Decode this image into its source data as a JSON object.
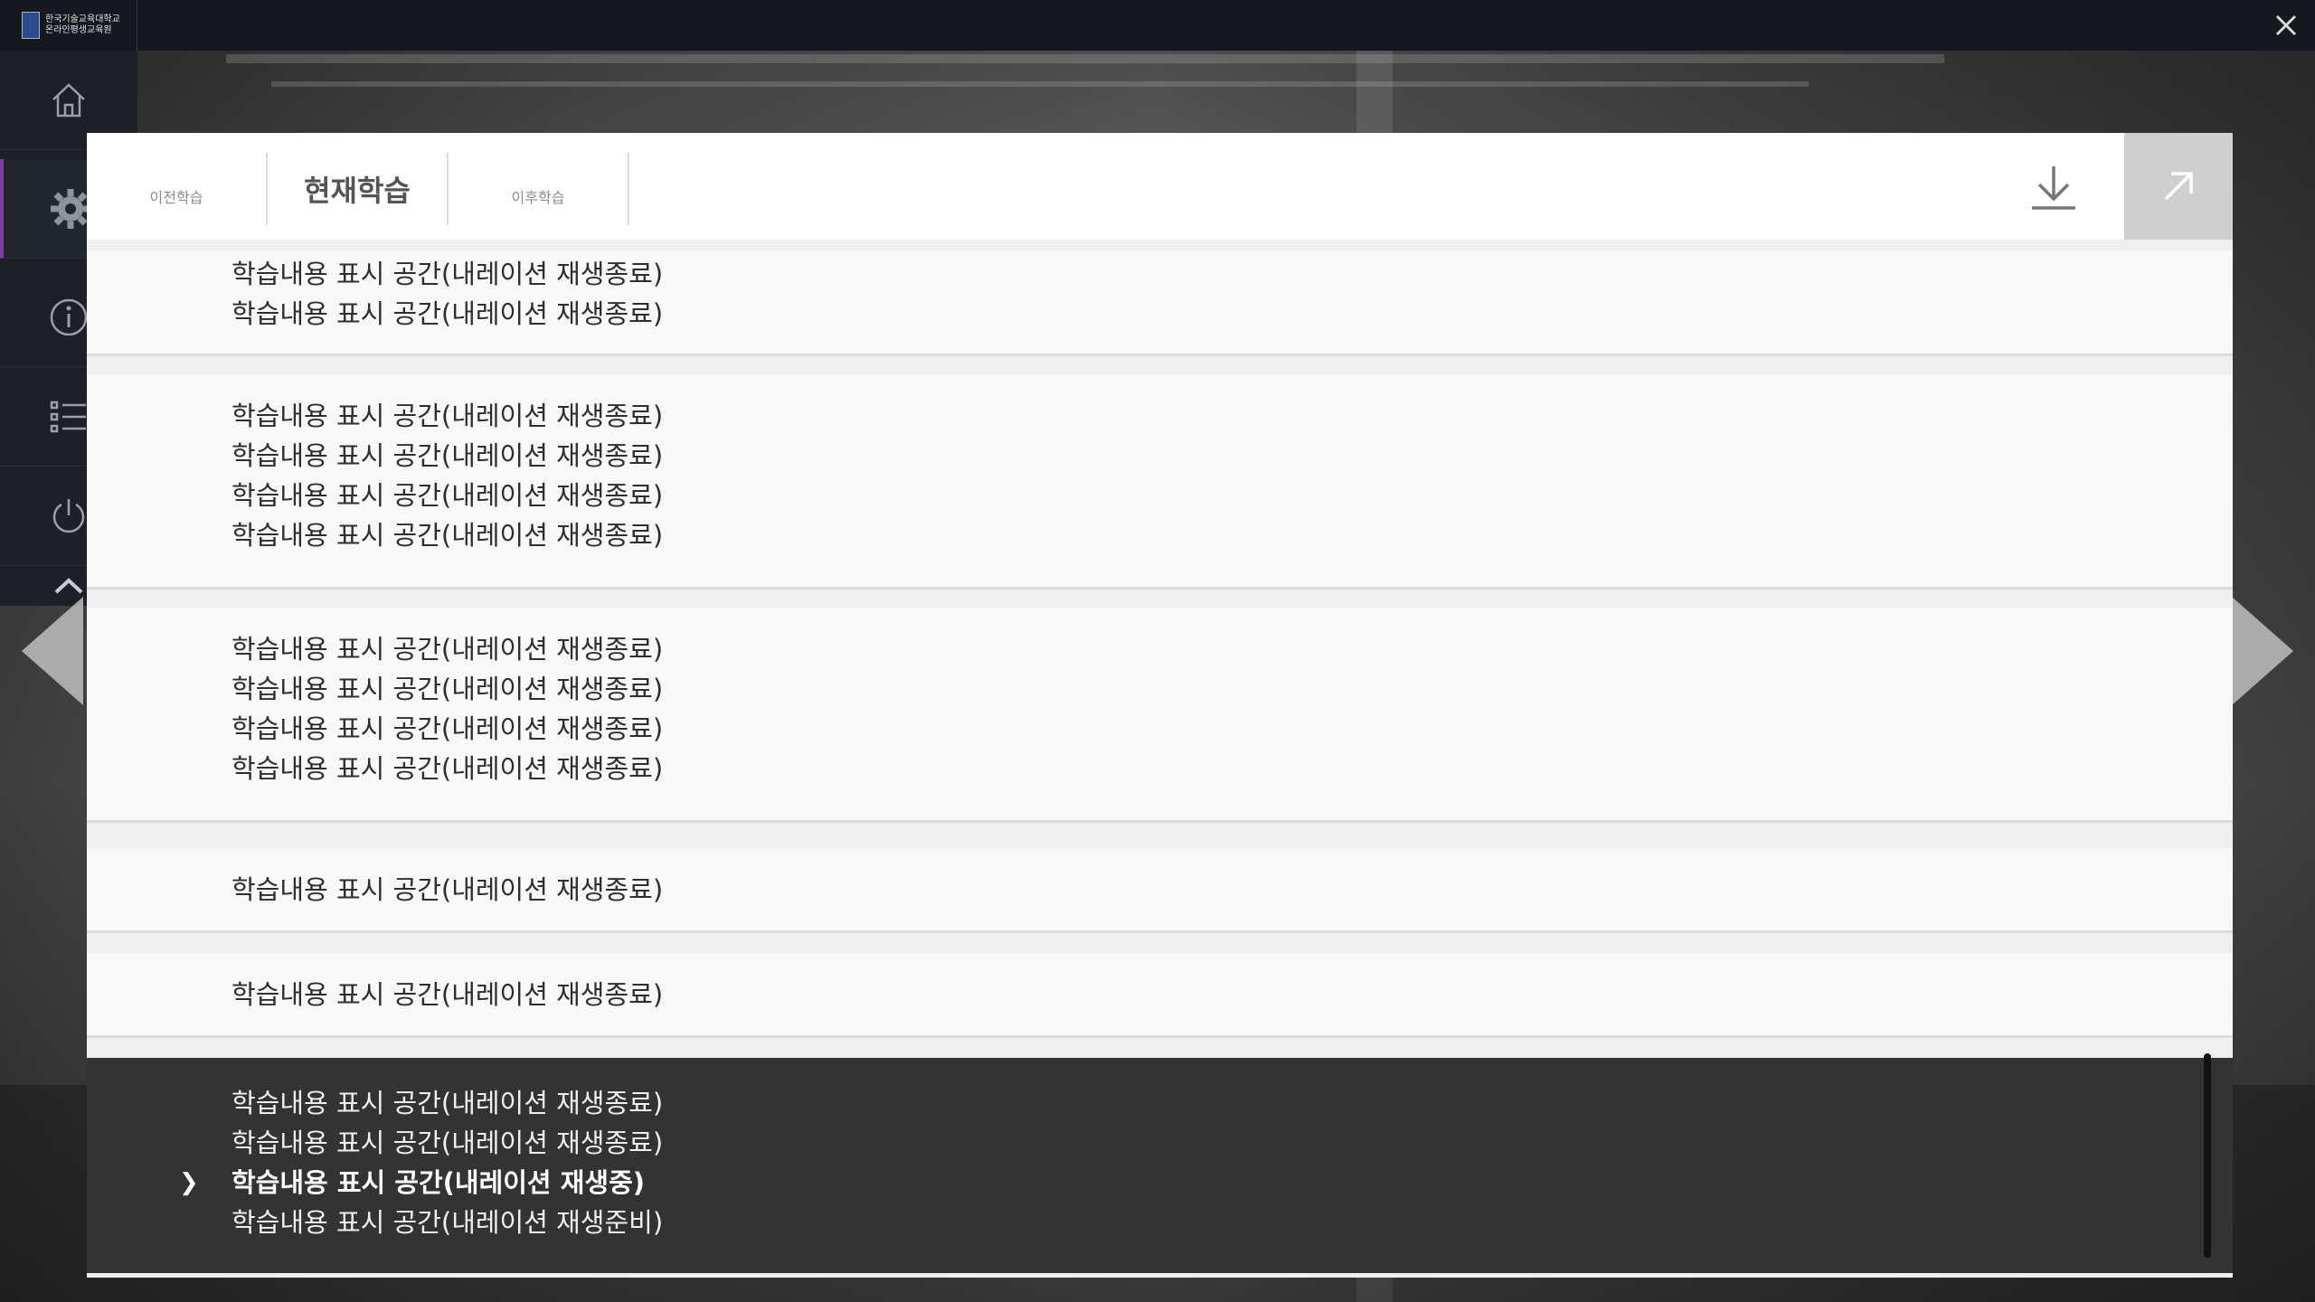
{
  "logo": {
    "line1": "한국기술교육대학교",
    "line2": "온라인평생교육원"
  },
  "tabs": {
    "prev": "이전학습",
    "current": "현재학습",
    "next": "이후학습"
  },
  "groups": [
    {
      "lines": [
        "학습내용 표시 공간(내레이션 재생종료)",
        "학습내용 표시 공간(내레이션 재생종료)"
      ]
    },
    {
      "lines": [
        "학습내용 표시 공간(내레이션 재생종료)",
        "학습내용 표시 공간(내레이션 재생종료)",
        "학습내용 표시 공간(내레이션 재생종료)",
        "학습내용 표시 공간(내레이션 재생종료)"
      ]
    },
    {
      "lines": [
        "학습내용 표시 공간(내레이션 재생종료)",
        "학습내용 표시 공간(내레이션 재생종료)",
        "학습내용 표시 공간(내레이션 재생종료)",
        "학습내용 표시 공간(내레이션 재생종료)"
      ]
    },
    {
      "lines": [
        "학습내용 표시 공간(내레이션 재생종료)"
      ]
    },
    {
      "lines": [
        "학습내용 표시 공간(내레이션 재생종료)"
      ]
    },
    {
      "lines": [
        "학습내용 표시 공간(내레이션 재생종료)",
        "학습내용 표시 공간(내레이션 재생종료)",
        "학습내용 표시 공간(내레이션 재생중)",
        "학습내용 표시 공간(내레이션 재생준비)"
      ]
    }
  ],
  "playing_marker": "❯",
  "icons": {
    "close": "close-icon",
    "home": "home-icon",
    "settings": "gear-icon",
    "info": "info-icon",
    "list": "list-icon",
    "power": "power-icon",
    "collapse": "chevron-up-icon",
    "download": "download-icon",
    "expand": "expand-arrow-icon",
    "prev": "chevron-left-icon",
    "next": "chevron-right-icon"
  },
  "colors": {
    "topbar": "#15181d",
    "sidebar": "#1d2026",
    "active_accent": "#7a3ea8",
    "current_section": "#333333"
  }
}
